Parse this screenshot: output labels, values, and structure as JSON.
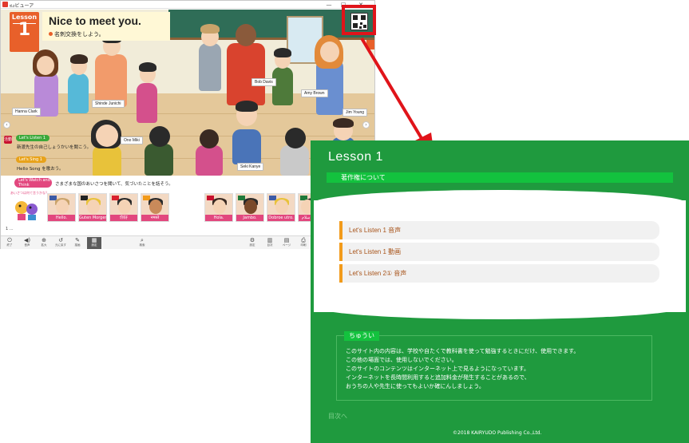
{
  "window": {
    "title": "ಠ೨ビューア",
    "minimize": "—",
    "maximize": "□",
    "close": "✕"
  },
  "lesson": {
    "badge_word": "Lesson",
    "badge_number": "1",
    "title": "Nice to meet you.",
    "subtitle": "名刺交換をしよう。"
  },
  "scene": {
    "names": [
      "Hanna Clark",
      "Shinde Junichi",
      "Bob Davis",
      "Amy Brown",
      "Jim Young",
      "Ono Miki",
      "Seki Kanye"
    ],
    "tasks": {
      "number": "活動",
      "listen_label": "Let's Listen 1",
      "listen_text": "新渡先生の自己しょうかいを聞こう。",
      "sing_label": "Let's Sing 1",
      "sing_text": "Hello Song を歌おう。"
    }
  },
  "strip": {
    "watch_label": "Let's Watch and Think",
    "watch_text": "さまざまな国のあいさつを聞いて、気づいたことを話そう。",
    "mascot_speech": "あいさつは何て言うかな？",
    "thumbs": [
      "Hello.",
      "Guten Morgen.",
      "你好",
      "नमस्ते",
      "Hola.",
      "Jambo.",
      "Dobroe utro.",
      "سلام"
    ],
    "foot": "1 ..."
  },
  "toolbar": {
    "tools": [
      {
        "icon": "⏻",
        "label": "終了"
      },
      {
        "icon": "◀)",
        "label": "音声"
      },
      {
        "icon": "⊕",
        "label": "拡大"
      },
      {
        "icon": "↺",
        "label": "元に戻す"
      },
      {
        "icon": "✎",
        "label": "描画"
      },
      {
        "icon": "▦",
        "label": "設定"
      },
      {
        "icon": "⌕",
        "label": "検索"
      },
      {
        "icon": "⚙",
        "label": "設定"
      },
      {
        "icon": "▥",
        "label": "目次"
      },
      {
        "icon": "▤",
        "label": "ページ"
      },
      {
        "icon": "⎙",
        "label": "印刷"
      }
    ]
  },
  "green_page": {
    "title": "Lesson 1",
    "copyright_bar": "著作権について",
    "items": [
      "Let's Listen 1 音声",
      "Let's Listen 1 動画",
      "Let's Listen 2① 音声"
    ],
    "notice_title": "ちゅうい",
    "notice_lines": [
      "このサイト内の内容は、学校や自たくで教科書を使って勉強するときにだけ、使用できます。",
      "この他の場面では、使用しないでください。",
      "このサイトのコンテンツはインターネット上で見るようになっています。",
      "インターネットを長時間利用すると追加料金が発生することがあるので、",
      "おうちの人や先生に使ってもよいか確にんしましょう。"
    ],
    "back_link": "目次へ",
    "copyright": "©2018 KAIRYUDO Publishing Co.,Ltd."
  },
  "colors": {
    "highlight": "#e0141a",
    "green_bg": "#1f9a3e",
    "green_bar": "#13c23e",
    "lesson_orange": "#e8602a",
    "item_accent": "#f29b1b"
  }
}
